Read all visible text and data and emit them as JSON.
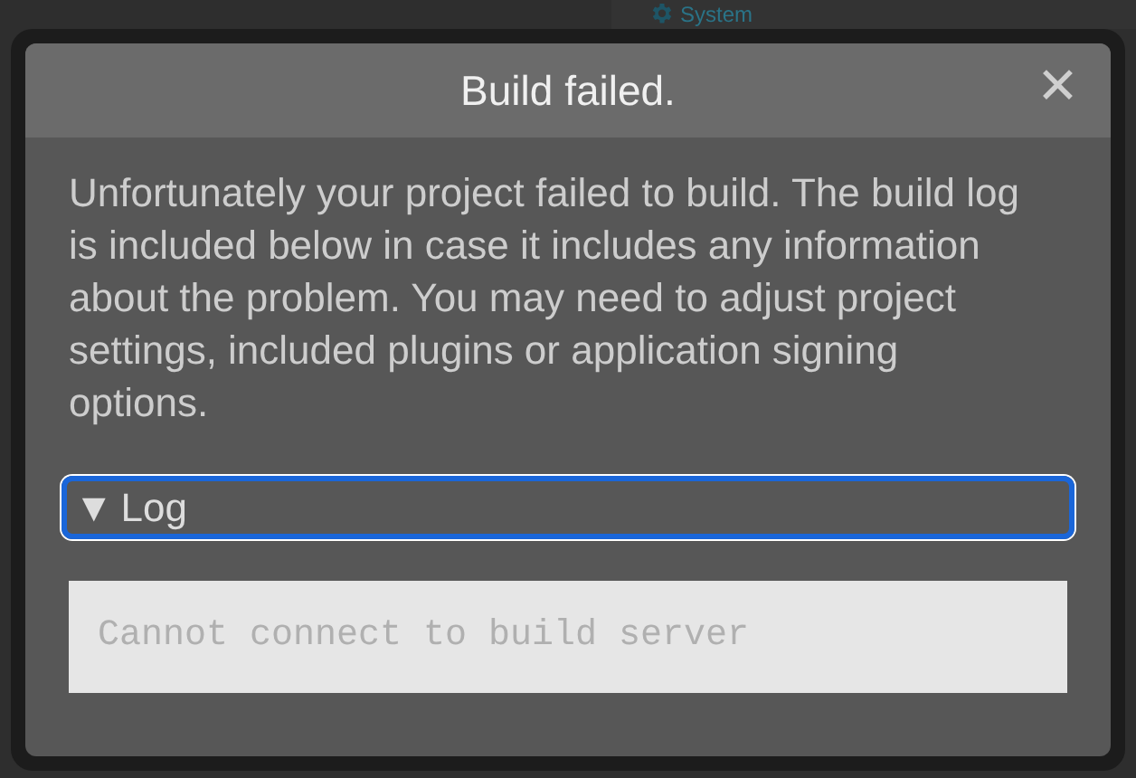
{
  "background": {
    "section_title": "System"
  },
  "dialog": {
    "title": "Build failed.",
    "close": "✕",
    "message": "Unfortunately your project failed to build. The build log is included below in case it includes any information about the problem. You may need to adjust project settings, included plugins or application signing options.",
    "log": {
      "label": "Log",
      "marker": "▼",
      "expanded": true,
      "focused": true,
      "content": "Cannot connect to build server"
    }
  }
}
